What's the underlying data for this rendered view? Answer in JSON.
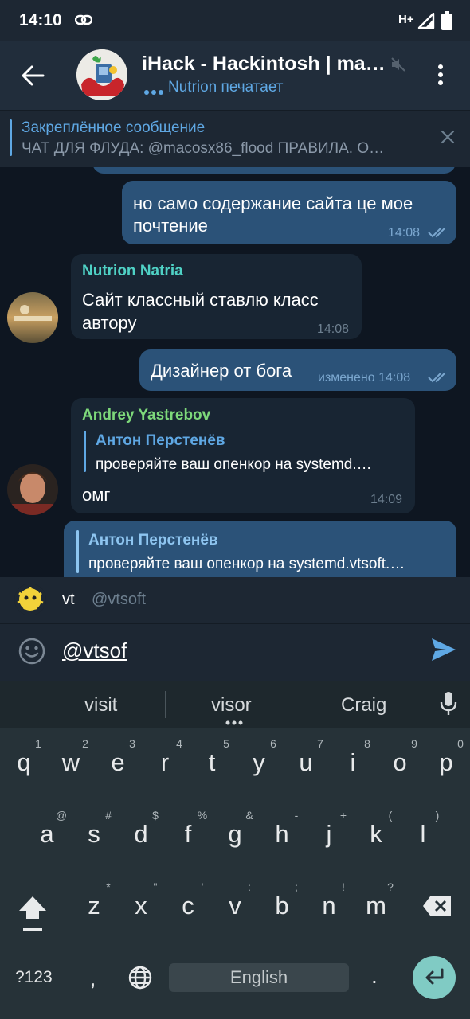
{
  "status": {
    "time": "14:10",
    "network": "H+"
  },
  "header": {
    "title": "iHack - Hackintosh | ma…",
    "typing": "Nutrion печатает"
  },
  "pinned": {
    "title": "Закреплённое сообщение",
    "text": "ЧАТ ДЛЯ ФЛУДА: @macosx86_flood ПРАВИЛА. О…"
  },
  "messages": [
    {
      "dir": "out",
      "text1": "но само содержание сайта це мое",
      "text2": "почтение",
      "time": "14:08"
    },
    {
      "dir": "in",
      "sender": "Nutrion Natria",
      "text1": "Сайт классный ставлю класс",
      "text2": "автору",
      "time": "14:08"
    },
    {
      "dir": "out",
      "text": "Дизайнер от бога",
      "meta": "изменено 14:08"
    },
    {
      "dir": "in",
      "sender": "Andrey Yastrebov",
      "reply_name": "Антон Перстенёв",
      "reply_text": "проверяйте ваш опенкор на systemd.…",
      "text": "омг",
      "time": "14:09"
    },
    {
      "dir": "out",
      "reply_name": "Антон Перстенёв",
      "reply_text": "проверяйте ваш опенкор на systemd.vtsoft.…"
    }
  ],
  "mention": {
    "name": "vt",
    "username": "@vtsoft"
  },
  "input": {
    "value": "@vtsof"
  },
  "keyboard": {
    "suggestions": [
      "visit",
      "visor",
      "Craig"
    ],
    "row1": [
      "q",
      "w",
      "e",
      "r",
      "t",
      "y",
      "u",
      "i",
      "o",
      "p"
    ],
    "row1_hints": [
      "1",
      "2",
      "3",
      "4",
      "5",
      "6",
      "7",
      "8",
      "9",
      "0"
    ],
    "row2": [
      "a",
      "s",
      "d",
      "f",
      "g",
      "h",
      "j",
      "k",
      "l"
    ],
    "row2_hints": [
      "@",
      "#",
      "$",
      "%",
      "&",
      "-",
      "+",
      "(",
      ")"
    ],
    "row3": [
      "z",
      "x",
      "c",
      "v",
      "b",
      "n",
      "m"
    ],
    "row3_hints": [
      "*",
      "\"",
      "'",
      ":",
      ";",
      "!",
      "?"
    ],
    "symbols_label": "?123",
    "comma": ",",
    "period": ".",
    "space_label": "English"
  },
  "colors": {
    "accent": "#5fa8e4",
    "outgoing_bubble": "#2b5278",
    "incoming_bubble": "#182533",
    "sender_cyan": "#4fd1c5",
    "sender_green": "#7dd87a",
    "enter_key": "#80cbc4"
  }
}
